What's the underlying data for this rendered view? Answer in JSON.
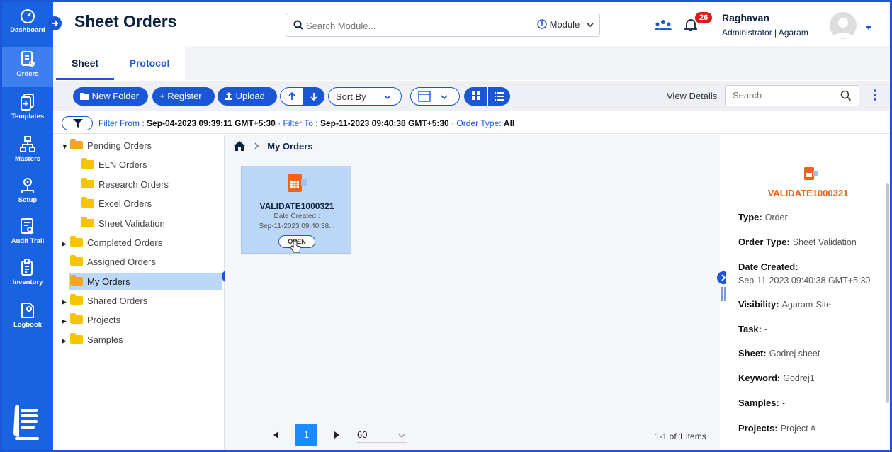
{
  "sidebar": {
    "items": [
      {
        "label": "Dashboard"
      },
      {
        "label": "Orders"
      },
      {
        "label": "Templates"
      },
      {
        "label": "Masters"
      },
      {
        "label": "Setup"
      },
      {
        "label": "Audit Trail"
      },
      {
        "label": "Inventory"
      },
      {
        "label": "Logbook"
      }
    ]
  },
  "header": {
    "title": "Sheet Orders",
    "search_placeholder": "Search Module...",
    "module_label": "Module",
    "notification_count": "26",
    "user_name": "Raghavan",
    "user_role": "Administrator | Agaram"
  },
  "tabs": [
    {
      "label": "Sheet"
    },
    {
      "label": "Protocol"
    }
  ],
  "toolbar": {
    "new_folder": "New Folder",
    "register": "Register",
    "upload": "Upload",
    "sort_by": "Sort By",
    "view_details": "View Details",
    "search_placeholder": "Search"
  },
  "filter": {
    "from_label": "Filter From :",
    "from_value": "Sep-04-2023 09:39:11 GMT+5:30",
    "to_label": "Filter To :",
    "to_value": "Sep-11-2023 09:40:38 GMT+5:30",
    "type_label": "Order Type:",
    "type_value": "All"
  },
  "tree": {
    "nodes": [
      {
        "label": "Pending Orders"
      },
      {
        "label": "ELN Orders"
      },
      {
        "label": "Research Orders"
      },
      {
        "label": "Excel Orders"
      },
      {
        "label": "Sheet Validation"
      },
      {
        "label": "Completed Orders"
      },
      {
        "label": "Assigned Orders"
      },
      {
        "label": "My Orders"
      },
      {
        "label": "Shared Orders"
      },
      {
        "label": "Projects"
      },
      {
        "label": "Samples"
      }
    ]
  },
  "content": {
    "breadcrumb": "My Orders",
    "card": {
      "title": "VALIDATE1000321",
      "date_label": "Date Created :",
      "date_value": "Sep-11-2023 09:40:38...",
      "open_label": "OPEN"
    },
    "pager": {
      "current_page": "1",
      "page_size": "60",
      "info": "1-1 of 1 items"
    }
  },
  "details": {
    "title": "VALIDATE1000321",
    "rows": [
      {
        "key": "Type:",
        "value": "Order"
      },
      {
        "key": "Order Type:",
        "value": "Sheet Validation"
      },
      {
        "key": "Date Created:",
        "value": "Sep-11-2023 09:40:38 GMT+5:30"
      },
      {
        "key": "Visibility:",
        "value": "Agaram-Site"
      },
      {
        "key": "Task:",
        "value": "-"
      },
      {
        "key": "Sheet:",
        "value": "Godrej sheet"
      },
      {
        "key": "Keyword:",
        "value": "Godrej1"
      },
      {
        "key": "Samples:",
        "value": "-"
      },
      {
        "key": "Projects:",
        "value": "Project A"
      }
    ]
  },
  "colors": {
    "primary": "#1a56d6",
    "sidebar": "#1a63e0",
    "accent_orange": "#f06418",
    "badge_red": "#e01818"
  }
}
